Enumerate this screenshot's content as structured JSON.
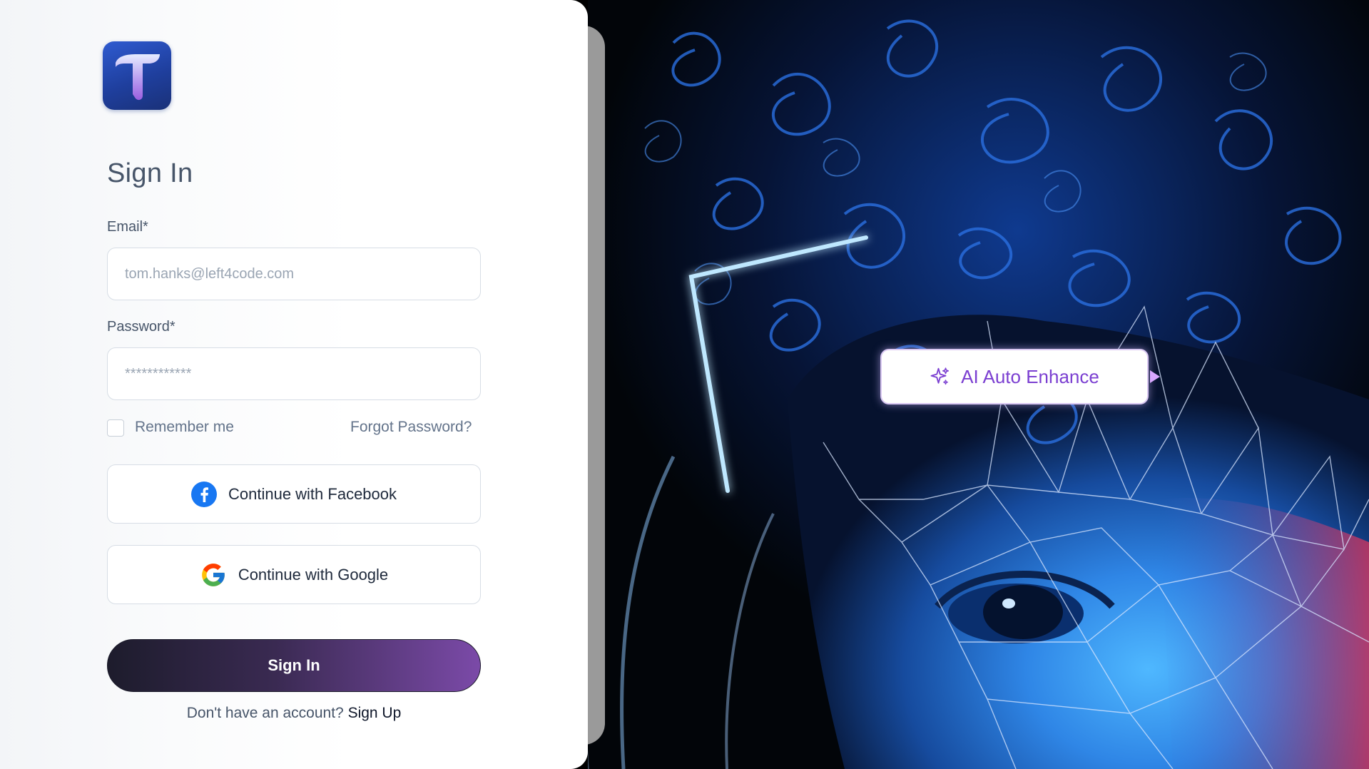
{
  "signin": {
    "title": "Sign In",
    "email_label": "Email*",
    "email_placeholder": "tom.hanks@left4code.com",
    "password_label": "Password*",
    "password_placeholder": "************",
    "remember_label": "Remember me",
    "forgot_label": "Forgot Password?",
    "facebook_label": "Continue with Facebook",
    "google_label": "Continue with Google",
    "submit_label": "Sign In",
    "no_account_text": "Don't have an account?",
    "signup_link": "Sign Up"
  },
  "hero": {
    "badge_label": "AI Auto Enhance"
  },
  "colors": {
    "accent_purple": "#7b4aa8",
    "button_dark": "#1d1c2c",
    "badge_text": "#7b3fd1",
    "facebook_blue": "#1877f2",
    "logo_blue": "#2f5bd0"
  },
  "icons": [
    "app-logo-icon",
    "facebook-icon",
    "google-icon",
    "sparkle-icon"
  ]
}
